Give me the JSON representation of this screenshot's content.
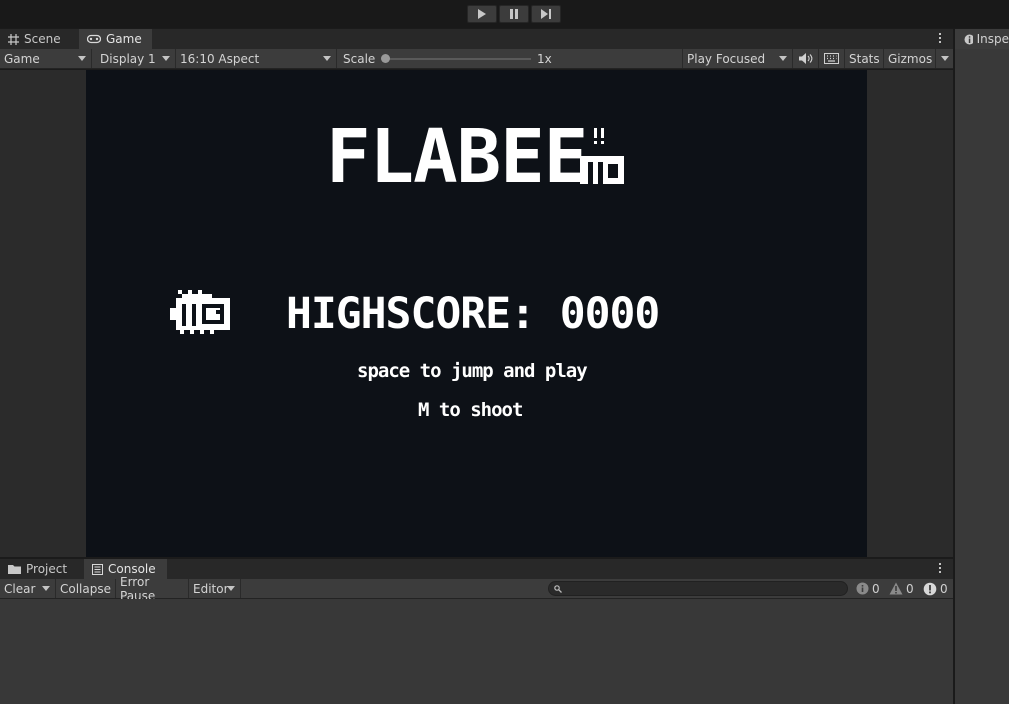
{
  "playbar": {
    "buttons": [
      {
        "name": "play-button",
        "icon": "play-icon"
      },
      {
        "name": "pause-button",
        "icon": "pause-icon"
      },
      {
        "name": "step-button",
        "icon": "step-icon"
      }
    ]
  },
  "tabs": {
    "scene_label": "Scene",
    "game_label": "Game"
  },
  "game_toolbar": {
    "view_mode": "Game",
    "display": "Display 1",
    "aspect": "16:10 Aspect",
    "scale_label": "Scale",
    "scale_value": "1x",
    "scale_fraction": 0,
    "play_mode": "Play Focused",
    "stats_label": "Stats",
    "gizmos_label": "Gizmos"
  },
  "game": {
    "title": "FLABEE",
    "highscore": "HIGHSCORE: 0000",
    "hint_jump": "space to jump and play",
    "hint_shoot": "M to shoot",
    "bg_color": "#0d1117",
    "text_color": "#ffffff"
  },
  "inspector": {
    "tab_label": "Inspe"
  },
  "bottom_tabs": {
    "project_label": "Project",
    "console_label": "Console"
  },
  "console_toolbar": {
    "clear_label": "Clear",
    "collapse_label": "Collapse",
    "error_pause_label": "Error Pause",
    "editor_label": "Editor",
    "info_count": "0",
    "warning_count": "0",
    "error_count": "0"
  }
}
